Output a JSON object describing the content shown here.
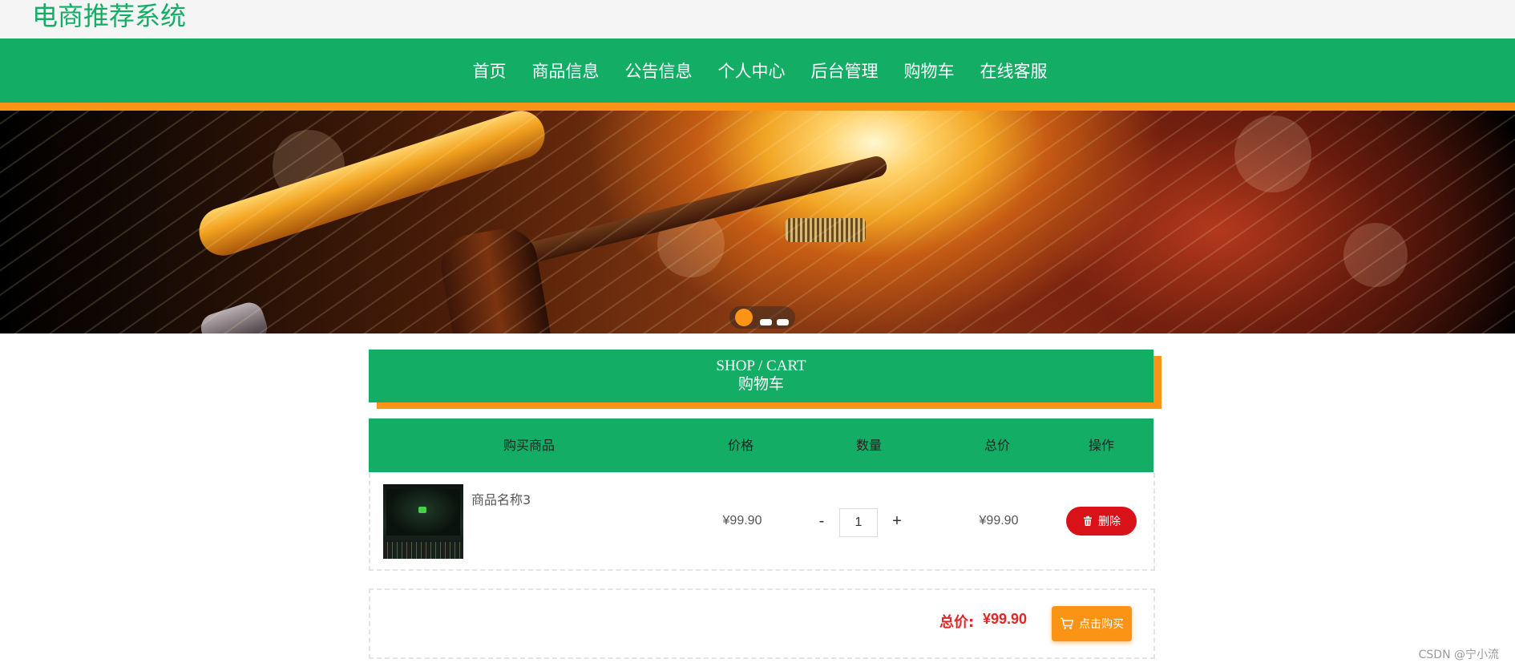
{
  "header": {
    "title": "电商推荐系统"
  },
  "nav": {
    "items": [
      {
        "label": "首页"
      },
      {
        "label": "商品信息"
      },
      {
        "label": "公告信息"
      },
      {
        "label": "个人中心"
      },
      {
        "label": "后台管理"
      },
      {
        "label": "购物车"
      },
      {
        "label": "在线客服"
      }
    ]
  },
  "banner": {
    "slide_count": 3,
    "active_slide": 1
  },
  "section": {
    "title_en": "SHOP / CART",
    "title_cn": "购物车"
  },
  "cart_table": {
    "headers": [
      "购买商品",
      "价格",
      "数量",
      "总价",
      "操作"
    ],
    "rows": [
      {
        "name": "商品名称3",
        "price": "¥99.90",
        "quantity": "1",
        "minus": "-",
        "plus": "+",
        "subtotal": "¥99.90",
        "delete_label": "删除"
      }
    ]
  },
  "summary": {
    "total_label": "总价:",
    "total_value": "¥99.90",
    "buy_label": "点击购买"
  },
  "watermark": "CSDN @宁小流",
  "colors": {
    "brand_green": "#14ad66",
    "accent_orange": "#fb9316",
    "danger_red": "#d9121a",
    "price_red": "#e32626"
  },
  "icons": {
    "delete": "trash-icon",
    "buy": "cart-icon"
  }
}
